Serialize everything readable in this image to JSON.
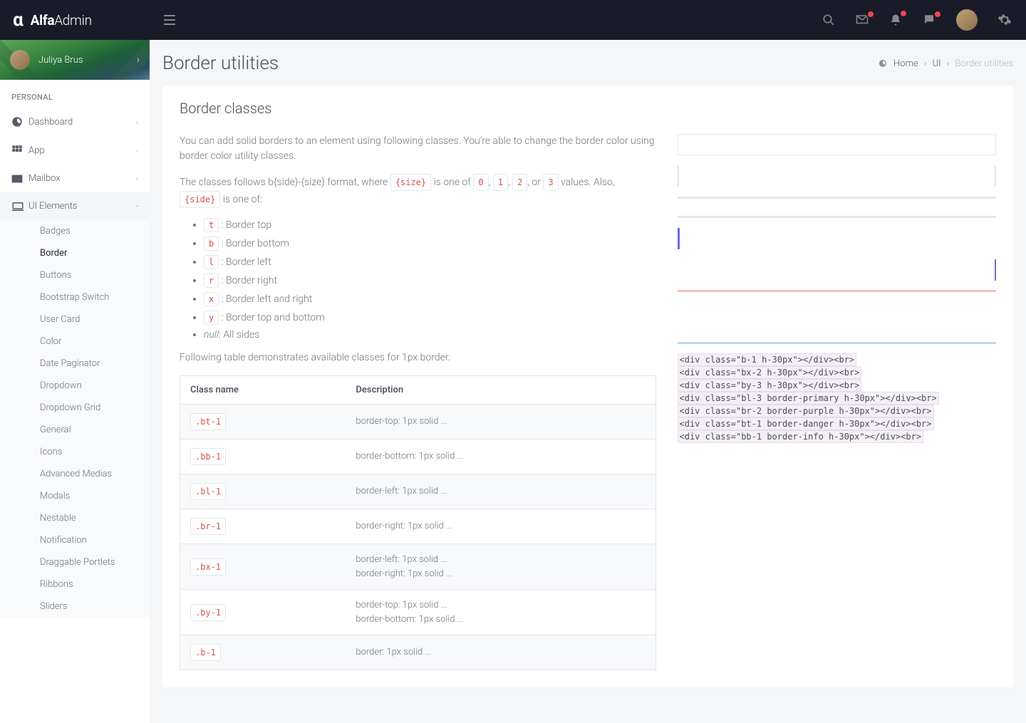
{
  "brand": {
    "name_bold": "Alfa",
    "name_light": "Admin"
  },
  "user": {
    "name": "Juliya Brus"
  },
  "sidebar": {
    "section": "PERSONAL",
    "items": [
      {
        "icon": "dashboard-icon",
        "label": "Dashboard",
        "expand": true
      },
      {
        "icon": "grid-icon",
        "label": "App",
        "expand": true
      },
      {
        "icon": "envelope-icon",
        "label": "Mailbox",
        "expand": true
      },
      {
        "icon": "laptop-icon",
        "label": "UI Elements",
        "expand": true,
        "open": true
      }
    ],
    "submenu": [
      "Badges",
      "Border",
      "Buttons",
      "Bootstrap Switch",
      "User Card",
      "Color",
      "Date Paginator",
      "Dropdown",
      "Dropdown Grid",
      "General",
      "Icons",
      "Advanced Medias",
      "Modals",
      "Nestable",
      "Notification",
      "Draggable Portlets",
      "Ribbons",
      "Sliders"
    ],
    "active_submenu": "Border"
  },
  "page": {
    "title": "Border utilities",
    "breadcrumb": {
      "home": "Home",
      "ui": "UI",
      "current": "Border utilities"
    }
  },
  "card": {
    "title": "Border classes",
    "intro1_a": "You can add solid borders to an element using following classes. You're able to change the border color using ",
    "intro1_b": "border color utility classes.",
    "intro2_a": "The classes follows b{side}-{size} format, where ",
    "token_size": "{size}",
    "intro2_b": " is one of ",
    "v0": "0",
    "v1": "1",
    "v2": "2",
    "intro2_or": ", or ",
    "v3": "3",
    "intro2_c": " values. Also, ",
    "token_side": "{side}",
    "intro2_d": " is one of:",
    "sides": [
      {
        "c": "t",
        "t": ": Border top"
      },
      {
        "c": "b",
        "t": ": Border bottom"
      },
      {
        "c": "l",
        "t": ": Border left"
      },
      {
        "c": "r",
        "t": ": Border right"
      },
      {
        "c": "x",
        "t": ": Border left and right"
      },
      {
        "c": "y",
        "t": ": Border top and bottom"
      }
    ],
    "side_null_a": "null",
    "side_null_b": ": All sides",
    "table_intro": "Following table demonstrates available classes for 1px border.",
    "th1": "Class name",
    "th2": "Description",
    "rows": [
      {
        "c": ".bt-1",
        "d": "border-top: 1px solid ..."
      },
      {
        "c": ".bb-1",
        "d": "border-bottom: 1px solid ..."
      },
      {
        "c": ".bl-1",
        "d": "border-left: 1px solid ..."
      },
      {
        "c": ".br-1",
        "d": "border-right: 1px solid ..."
      },
      {
        "c": ".bx-1",
        "d": "border-left: 1px solid ...\nborder-right: 1px solid ..."
      },
      {
        "c": ".by-1",
        "d": "border-top: 1px solid ...\nborder-bottom: 1px solid ..."
      },
      {
        "c": ".b-1",
        "d": "border: 1px solid ..."
      }
    ],
    "code_lines": [
      "<div class=\"b-1 h-30px\"></div><br>",
      "<div class=\"bx-2 h-30px\"></div><br>",
      "<div class=\"by-3 h-30px\"></div><br>",
      "<div class=\"bl-3 border-primary h-30px\"></div><br>",
      "<div class=\"br-2 border-purple h-30px\"></div><br>",
      "<div class=\"bt-1 border-danger h-30px\"></div><br>",
      "<div class=\"bb-1 border-info h-30px\"></div><br>"
    ]
  }
}
